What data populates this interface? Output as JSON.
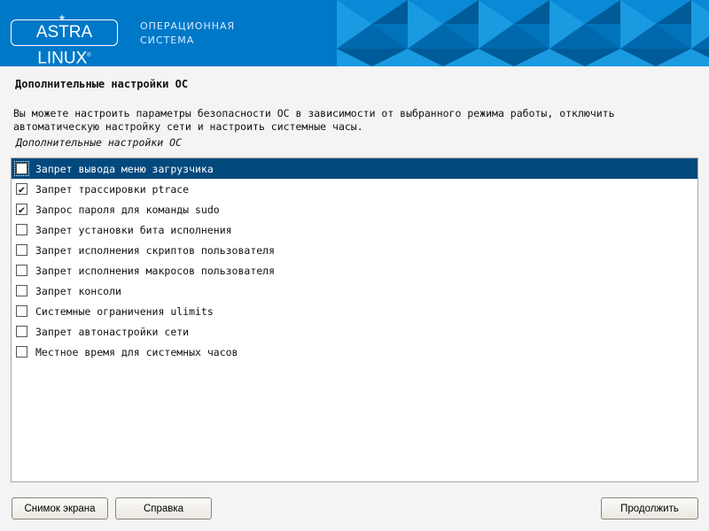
{
  "header": {
    "logo": "ASTRA LINUX",
    "logo_mark": "®",
    "subtitle_line1": "ОПЕРАЦИОННАЯ",
    "subtitle_line2": "СИСТЕМА"
  },
  "page": {
    "title": "Дополнительные настройки ОС",
    "description": "Вы можете настроить параметры безопасности ОС в зависимости от выбранного режима работы, отключить автоматическую настройку сети и настроить системные часы.",
    "list_label": "Дополнительные настройки ОС"
  },
  "options": [
    {
      "label": "Запрет вывода меню загрузчика",
      "checked": false,
      "selected": true
    },
    {
      "label": "Запрет трассировки ptrace",
      "checked": true
    },
    {
      "label": "Запрос пароля для команды sudo",
      "checked": true
    },
    {
      "label": "Запрет установки бита исполнения",
      "checked": false
    },
    {
      "label": "Запрет исполнения скриптов пользователя",
      "checked": false
    },
    {
      "label": "Запрет исполнения макросов пользователя",
      "checked": false
    },
    {
      "label": "Запрет консоли",
      "checked": false
    },
    {
      "label": "Системные ограничения ulimits",
      "checked": false
    },
    {
      "label": "Запрет автонастройки сети",
      "checked": false
    },
    {
      "label": "Местное время для системных часов",
      "checked": false
    }
  ],
  "buttons": {
    "screenshot": "Снимок экрана",
    "help": "Справка",
    "continue": "Продолжить"
  },
  "colors": {
    "header": "#0078c8",
    "selection": "#02497d"
  }
}
